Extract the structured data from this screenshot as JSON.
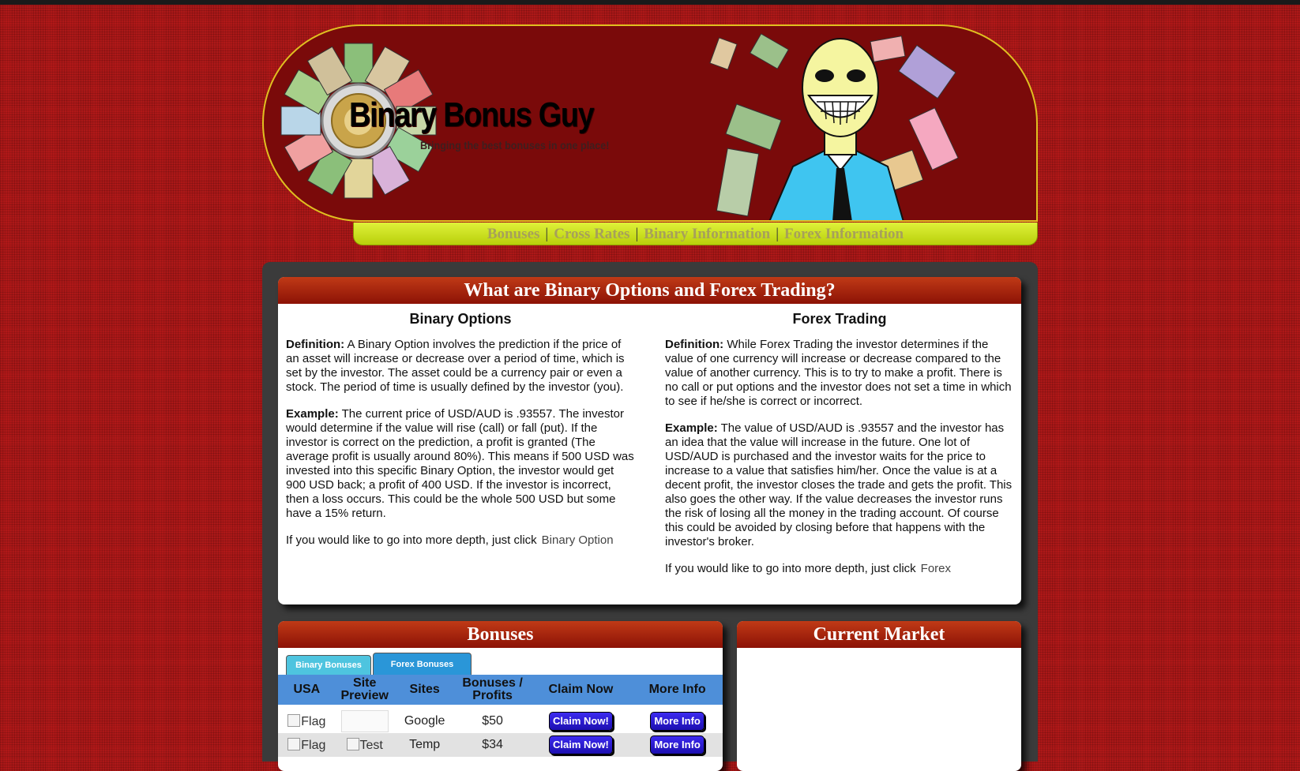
{
  "header": {
    "title": "Binary Bonus Guy",
    "tagline": "Bringing the best bonuses in one place!"
  },
  "nav": {
    "items": [
      {
        "label": "Bonuses"
      },
      {
        "label": "Cross Rates"
      },
      {
        "label": "Binary Information"
      },
      {
        "label": "Forex Information"
      }
    ],
    "separator": "|"
  },
  "info": {
    "title": "What are Binary Options and Forex Trading?",
    "binary": {
      "heading": "Binary Options",
      "definition_label": "Definition:",
      "definition": "A Binary Option involves the prediction if the price of an asset will increase or decrease over a period of time, which is set by the investor. The asset could be a currency pair or even a stock. The period of time is usually defined by the investor (you).",
      "example_label": "Example:",
      "example": "The current price of USD/AUD is .93557. The investor would determine if the value will rise (call) or fall (put). If the investor is correct on the prediction, a profit is granted (The average profit is usually around 80%). This means if 500 USD was invested into this specific Binary Option, the investor would get 900 USD back; a profit of 400 USD. If the investor is incorrect, then a loss occurs. This could be the whole 500 USD but some have a 15% return.",
      "more_text": "If you would like to go into more depth, just click",
      "more_link": "Binary Option"
    },
    "forex": {
      "heading": "Forex Trading",
      "definition_label": "Definition:",
      "definition": "While Forex Trading the investor determines if the value of one currency will increase or decrease compared to the value of another currency. This is to try to make a profit. There is no call or put options and the investor does not set a time in which to see if he/she is correct or incorrect.",
      "example_label": "Example:",
      "example": "The value of USD/AUD is .93557 and the investor has an idea that the value will increase in the future. One lot of USD/AUD is purchased and the investor waits for the price to increase to a value that satisfies him/her. Once the value is at a decent profit, the investor closes the trade and gets the profit. This also goes the other way. If the value decreases the investor runs the risk of losing all the money in the trading account. Of course this could be avoided by closing before that happens with the investor's broker.",
      "more_text": "If you would like to go into more depth, just click",
      "more_link": "Forex"
    }
  },
  "bonuses": {
    "title": "Bonuses",
    "tabs": [
      {
        "label": "Binary Bonuses"
      },
      {
        "label": "Forex Bonuses"
      }
    ],
    "columns": [
      "USA",
      "Site Preview",
      "Sites",
      "Bonuses / Profits",
      "Claim Now",
      "More Info"
    ],
    "rows": [
      {
        "flag": "Flag",
        "preview": "",
        "site": "Google",
        "bonus": "$50",
        "claim": "Claim Now!",
        "info": "More Info"
      },
      {
        "flag": "Flag",
        "preview": "Test",
        "site": "Temp",
        "bonus": "$34",
        "claim": "Claim Now!",
        "info": "More Info"
      }
    ]
  },
  "market": {
    "title": "Current Market"
  }
}
